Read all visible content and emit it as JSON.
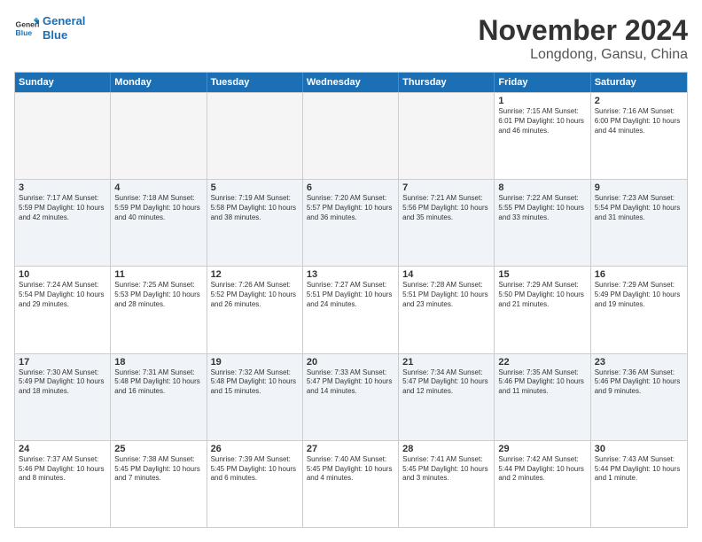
{
  "logo": {
    "line1": "General",
    "line2": "Blue"
  },
  "title": "November 2024",
  "location": "Longdong, Gansu, China",
  "header_days": [
    "Sunday",
    "Monday",
    "Tuesday",
    "Wednesday",
    "Thursday",
    "Friday",
    "Saturday"
  ],
  "rows": [
    [
      {
        "day": "",
        "info": "",
        "empty": true
      },
      {
        "day": "",
        "info": "",
        "empty": true
      },
      {
        "day": "",
        "info": "",
        "empty": true
      },
      {
        "day": "",
        "info": "",
        "empty": true
      },
      {
        "day": "",
        "info": "",
        "empty": true
      },
      {
        "day": "1",
        "info": "Sunrise: 7:15 AM\nSunset: 6:01 PM\nDaylight: 10 hours\nand 46 minutes.",
        "empty": false
      },
      {
        "day": "2",
        "info": "Sunrise: 7:16 AM\nSunset: 6:00 PM\nDaylight: 10 hours\nand 44 minutes.",
        "empty": false
      }
    ],
    [
      {
        "day": "3",
        "info": "Sunrise: 7:17 AM\nSunset: 5:59 PM\nDaylight: 10 hours\nand 42 minutes.",
        "empty": false
      },
      {
        "day": "4",
        "info": "Sunrise: 7:18 AM\nSunset: 5:59 PM\nDaylight: 10 hours\nand 40 minutes.",
        "empty": false
      },
      {
        "day": "5",
        "info": "Sunrise: 7:19 AM\nSunset: 5:58 PM\nDaylight: 10 hours\nand 38 minutes.",
        "empty": false
      },
      {
        "day": "6",
        "info": "Sunrise: 7:20 AM\nSunset: 5:57 PM\nDaylight: 10 hours\nand 36 minutes.",
        "empty": false
      },
      {
        "day": "7",
        "info": "Sunrise: 7:21 AM\nSunset: 5:56 PM\nDaylight: 10 hours\nand 35 minutes.",
        "empty": false
      },
      {
        "day": "8",
        "info": "Sunrise: 7:22 AM\nSunset: 5:55 PM\nDaylight: 10 hours\nand 33 minutes.",
        "empty": false
      },
      {
        "day": "9",
        "info": "Sunrise: 7:23 AM\nSunset: 5:54 PM\nDaylight: 10 hours\nand 31 minutes.",
        "empty": false
      }
    ],
    [
      {
        "day": "10",
        "info": "Sunrise: 7:24 AM\nSunset: 5:54 PM\nDaylight: 10 hours\nand 29 minutes.",
        "empty": false
      },
      {
        "day": "11",
        "info": "Sunrise: 7:25 AM\nSunset: 5:53 PM\nDaylight: 10 hours\nand 28 minutes.",
        "empty": false
      },
      {
        "day": "12",
        "info": "Sunrise: 7:26 AM\nSunset: 5:52 PM\nDaylight: 10 hours\nand 26 minutes.",
        "empty": false
      },
      {
        "day": "13",
        "info": "Sunrise: 7:27 AM\nSunset: 5:51 PM\nDaylight: 10 hours\nand 24 minutes.",
        "empty": false
      },
      {
        "day": "14",
        "info": "Sunrise: 7:28 AM\nSunset: 5:51 PM\nDaylight: 10 hours\nand 23 minutes.",
        "empty": false
      },
      {
        "day": "15",
        "info": "Sunrise: 7:29 AM\nSunset: 5:50 PM\nDaylight: 10 hours\nand 21 minutes.",
        "empty": false
      },
      {
        "day": "16",
        "info": "Sunrise: 7:29 AM\nSunset: 5:49 PM\nDaylight: 10 hours\nand 19 minutes.",
        "empty": false
      }
    ],
    [
      {
        "day": "17",
        "info": "Sunrise: 7:30 AM\nSunset: 5:49 PM\nDaylight: 10 hours\nand 18 minutes.",
        "empty": false
      },
      {
        "day": "18",
        "info": "Sunrise: 7:31 AM\nSunset: 5:48 PM\nDaylight: 10 hours\nand 16 minutes.",
        "empty": false
      },
      {
        "day": "19",
        "info": "Sunrise: 7:32 AM\nSunset: 5:48 PM\nDaylight: 10 hours\nand 15 minutes.",
        "empty": false
      },
      {
        "day": "20",
        "info": "Sunrise: 7:33 AM\nSunset: 5:47 PM\nDaylight: 10 hours\nand 14 minutes.",
        "empty": false
      },
      {
        "day": "21",
        "info": "Sunrise: 7:34 AM\nSunset: 5:47 PM\nDaylight: 10 hours\nand 12 minutes.",
        "empty": false
      },
      {
        "day": "22",
        "info": "Sunrise: 7:35 AM\nSunset: 5:46 PM\nDaylight: 10 hours\nand 11 minutes.",
        "empty": false
      },
      {
        "day": "23",
        "info": "Sunrise: 7:36 AM\nSunset: 5:46 PM\nDaylight: 10 hours\nand 9 minutes.",
        "empty": false
      }
    ],
    [
      {
        "day": "24",
        "info": "Sunrise: 7:37 AM\nSunset: 5:46 PM\nDaylight: 10 hours\nand 8 minutes.",
        "empty": false
      },
      {
        "day": "25",
        "info": "Sunrise: 7:38 AM\nSunset: 5:45 PM\nDaylight: 10 hours\nand 7 minutes.",
        "empty": false
      },
      {
        "day": "26",
        "info": "Sunrise: 7:39 AM\nSunset: 5:45 PM\nDaylight: 10 hours\nand 6 minutes.",
        "empty": false
      },
      {
        "day": "27",
        "info": "Sunrise: 7:40 AM\nSunset: 5:45 PM\nDaylight: 10 hours\nand 4 minutes.",
        "empty": false
      },
      {
        "day": "28",
        "info": "Sunrise: 7:41 AM\nSunset: 5:45 PM\nDaylight: 10 hours\nand 3 minutes.",
        "empty": false
      },
      {
        "day": "29",
        "info": "Sunrise: 7:42 AM\nSunset: 5:44 PM\nDaylight: 10 hours\nand 2 minutes.",
        "empty": false
      },
      {
        "day": "30",
        "info": "Sunrise: 7:43 AM\nSunset: 5:44 PM\nDaylight: 10 hours\nand 1 minute.",
        "empty": false
      }
    ]
  ]
}
